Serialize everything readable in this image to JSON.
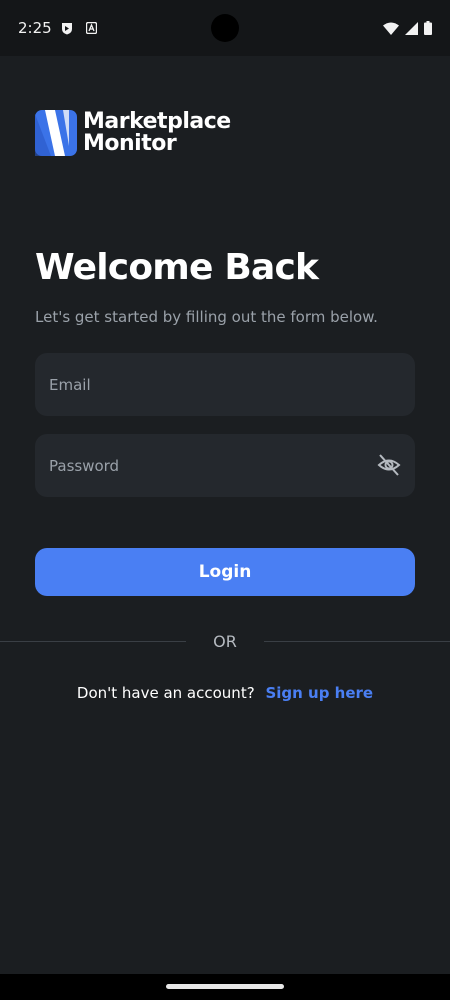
{
  "status_bar": {
    "time": "2:25",
    "icons": [
      "shield-icon",
      "a-icon",
      "wifi-icon",
      "signal-icon",
      "battery-icon"
    ]
  },
  "logo": {
    "line1": "Marketplace",
    "line2": "Monitor"
  },
  "welcome": {
    "title": "Welcome Back",
    "subtitle": "Let's get started by filling out the form below."
  },
  "form": {
    "email_placeholder": "Email",
    "email_value": "",
    "password_placeholder": "Password",
    "password_value": "",
    "login_label": "Login"
  },
  "divider": {
    "text": "OR"
  },
  "signup": {
    "prompt": "Don't have an account?",
    "link": "Sign up here"
  },
  "colors": {
    "background": "#1b1e21",
    "field": "#24282d",
    "accent": "#4a7ff3",
    "muted_text": "#9aa1a9"
  }
}
